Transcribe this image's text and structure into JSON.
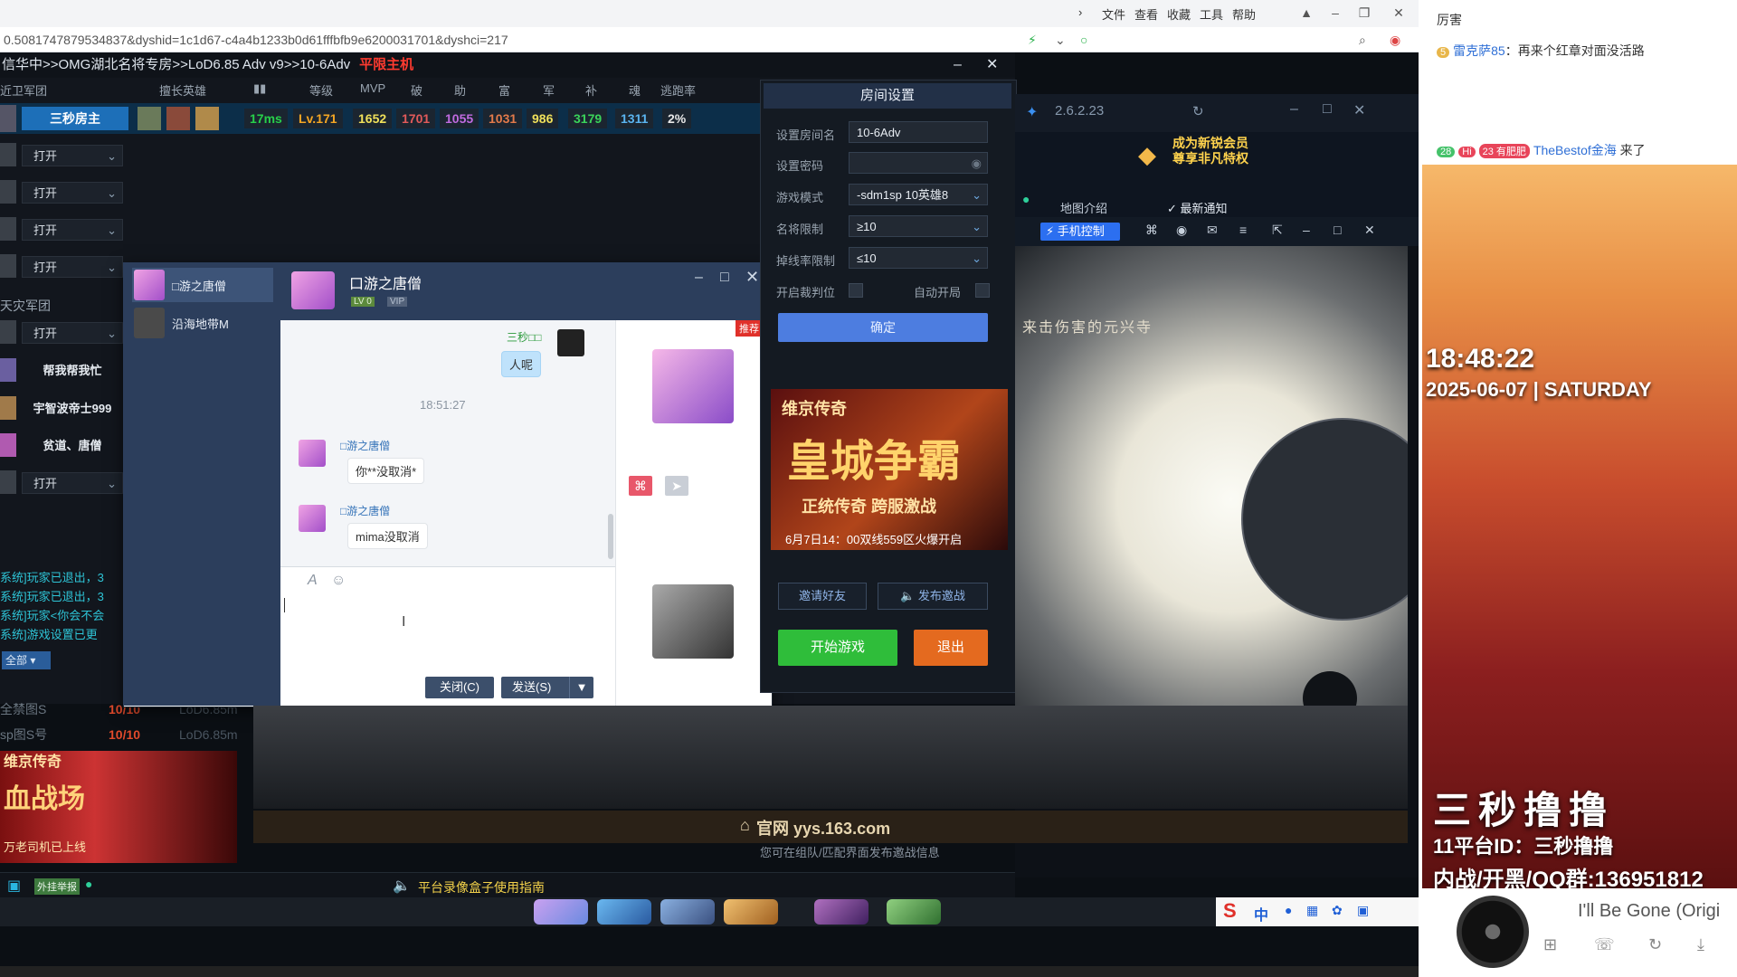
{
  "browser": {
    "menu": [
      "文件",
      "查看",
      "收藏",
      "工具",
      "帮助"
    ],
    "url": "0.5081747879534837&dyshid=1c1d67-c4a4b1233b0d61fffbfb9e6200031701&dyshci=217"
  },
  "lobby": {
    "title": "信华中>>OMG湖北名将专房>>LoD6.85 Adv v9>>10-6Adv",
    "host_label": "平限主机",
    "headers": [
      "擅长英雄",
      "等级",
      "MVP",
      "破",
      "助",
      "富",
      "军",
      "补",
      "魂",
      "逃跑率"
    ],
    "team1_label": "近卫军团",
    "team2_label": "天灾军团",
    "player": {
      "name": "三秒房主",
      "ping": "17ms",
      "level": "Lv.171",
      "stats": [
        "1652",
        "1701",
        "1055",
        "1031",
        "986",
        "3179",
        "1311",
        "2%"
      ]
    },
    "open_label": "打开",
    "team2_players": [
      "帮我帮我忙",
      "宇智波帝士999",
      "贫道、唐僧"
    ],
    "sys_log": [
      "系统]玩家已退出，3",
      "系统]玩家已退出，3",
      "系统]玩家<你会不会",
      "系统]游戏设置已更"
    ],
    "all_label": "全部",
    "rooms": [
      {
        "name": "全禁图S",
        "count": "10/10",
        "map": "LoD6.85m"
      },
      {
        "name": "sp图S号",
        "count": "10/10",
        "map": "LoD6.85m"
      }
    ],
    "ad_left": {
      "title": "血战场",
      "brand": "维京传奇",
      "sub": "万老司机已上线"
    },
    "guide": "平台录像盒子使用指南",
    "bottom_tag": "外挂举报"
  },
  "chat": {
    "friends": [
      "□游之唐僧",
      "沿海地带M"
    ],
    "title": "口游之唐僧",
    "level_badge": "LV 0",
    "vip_badge": "VIP",
    "recommend": "推荐",
    "me_name": "三秒□□",
    "me_msg": "人呢",
    "time": "18:51:27",
    "messages": [
      {
        "sender": "□游之唐僧",
        "text": "你**没取消*"
      },
      {
        "sender": "□游之唐僧",
        "text": "mima没取消"
      }
    ],
    "close_btn": "关闭(C)",
    "send_btn": "发送(S)"
  },
  "room": {
    "title": "房间设置",
    "fields": [
      {
        "label": "设置房间名",
        "value": "10-6Adv"
      },
      {
        "label": "设置密码",
        "value": ""
      },
      {
        "label": "游戏模式",
        "value": "-sdm1sp 10英雄8"
      },
      {
        "label": "名将限制",
        "value": "≥10"
      },
      {
        "label": "掉线率限制",
        "value": "≤10"
      }
    ],
    "judge_label": "开启裁判位",
    "auto_label": "自动开局",
    "confirm": "确定",
    "ad": {
      "brand": "维京传奇",
      "big": "皇城争霸",
      "mid": "正统传奇 跨服激战",
      "small": "6月7日14：00双线559区火爆开启"
    },
    "invite": "邀请好友",
    "publish": "发布邀战",
    "start": "开始游戏",
    "exit": "退出"
  },
  "launcher": {
    "version": "2.6.2.23",
    "vip_line1": "成为新锐会员",
    "vip_line2": "尊享非凡特权",
    "map_intro": "地图介绍",
    "news": "最新通知",
    "phone_control": "手机控制",
    "art_caption": "来击伤害的元兴寺",
    "site": "官网 yys.163.com",
    "org_tip": "您可在组队/匹配界面发布邀战信息",
    "ime_cn": "中"
  },
  "stream": {
    "feed": [
      {
        "user": "",
        "text": "厉害"
      },
      {
        "badge": "5",
        "user": "雷克萨85",
        "text": "：再来个红章对面没活路"
      },
      {
        "badge": "28",
        "badge2": "23 有肥肥",
        "user": "TheBestof金海",
        "text": " 来了"
      }
    ],
    "clock": "18:48:22",
    "date": "2025-06-07 | SATURDAY",
    "name": "三秒撸撸",
    "platform_id": "11平台ID：三秒撸撸",
    "group": "内战/开黑/QQ群:136951812",
    "song": "I'll Be Gone (Origi"
  }
}
